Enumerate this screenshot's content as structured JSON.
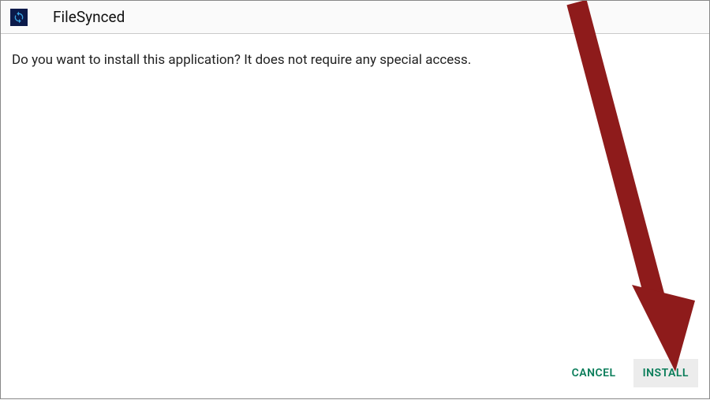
{
  "header": {
    "app_name": "FileSynced"
  },
  "content": {
    "prompt": "Do you want to install this application? It does not require any special access."
  },
  "actions": {
    "cancel_label": "CANCEL",
    "install_label": "INSTALL"
  },
  "colors": {
    "accent": "#0a7d5a",
    "arrow": "#8e1b1b"
  }
}
